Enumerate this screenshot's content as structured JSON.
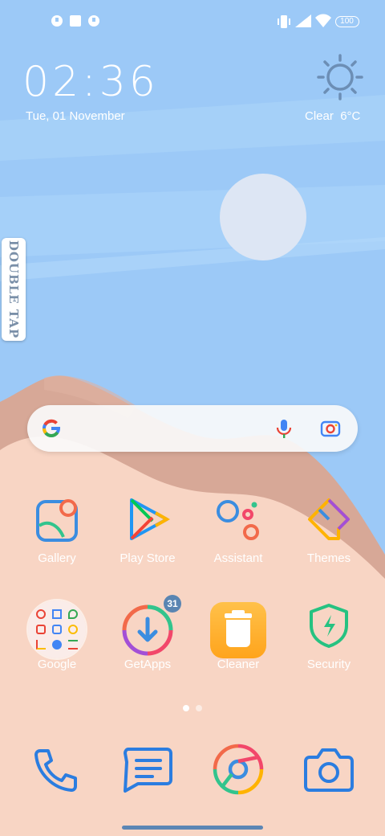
{
  "status_bar": {
    "battery": "100",
    "icons": [
      "notification-icon",
      "stop-icon",
      "notification-icon",
      "vibrate-icon",
      "signal-icon",
      "wifi-icon",
      "battery-icon"
    ]
  },
  "clock_widget": {
    "time": "02:36",
    "date": "Tue, 01 November"
  },
  "weather_widget": {
    "condition": "Clear",
    "temp": "6°C",
    "text": "Clear  6°C",
    "icon": "sun-icon"
  },
  "side_tab": {
    "label": "DOUBLE TAP"
  },
  "search_bar": {
    "logo": "google-logo",
    "icons": [
      "mic-icon",
      "lens-icon"
    ]
  },
  "apps_row1": [
    {
      "label": "Gallery",
      "icon": "gallery-icon"
    },
    {
      "label": "Play Store",
      "icon": "play-store-icon"
    },
    {
      "label": "Assistant",
      "icon": "assistant-icon"
    },
    {
      "label": "Themes",
      "icon": "themes-icon"
    }
  ],
  "apps_row2": [
    {
      "label": "Google",
      "icon": "google-folder-icon"
    },
    {
      "label": "GetApps",
      "icon": "getapps-icon",
      "badge": "31"
    },
    {
      "label": "Cleaner",
      "icon": "cleaner-icon"
    },
    {
      "label": "Security",
      "icon": "security-icon"
    }
  ],
  "page_indicator": {
    "pages": 2,
    "current": 1
  },
  "dock": [
    {
      "icon": "phone-icon"
    },
    {
      "icon": "messages-icon"
    },
    {
      "icon": "browser-icon"
    },
    {
      "icon": "camera-icon"
    }
  ],
  "colors": {
    "sky": "#9cc9f7",
    "sand": "#f8d5c4",
    "dune": "#d6a898",
    "accent": "#5b86b5"
  }
}
